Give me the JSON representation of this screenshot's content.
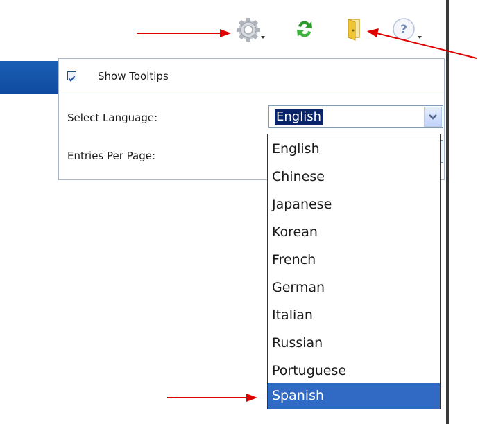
{
  "toolbar": {
    "icons": [
      "settings-gear-icon",
      "refresh-icon",
      "exit-door-icon",
      "help-icon"
    ]
  },
  "settings_panel": {
    "show_tooltips_label": "Show Tooltips",
    "show_tooltips_checked": true,
    "select_language_label": "Select Language:",
    "selected_language": "English",
    "entries_per_page_label": "Entries Per Page:"
  },
  "language_dropdown": {
    "options": [
      "English",
      "Chinese",
      "Japanese",
      "Korean",
      "French",
      "German",
      "Italian",
      "Russian",
      "Portuguese",
      "Spanish"
    ],
    "highlighted": "Spanish"
  },
  "colors": {
    "annotation_arrow": "#e00000",
    "selection": "#316ac5",
    "text_selection": "#0a246a"
  }
}
